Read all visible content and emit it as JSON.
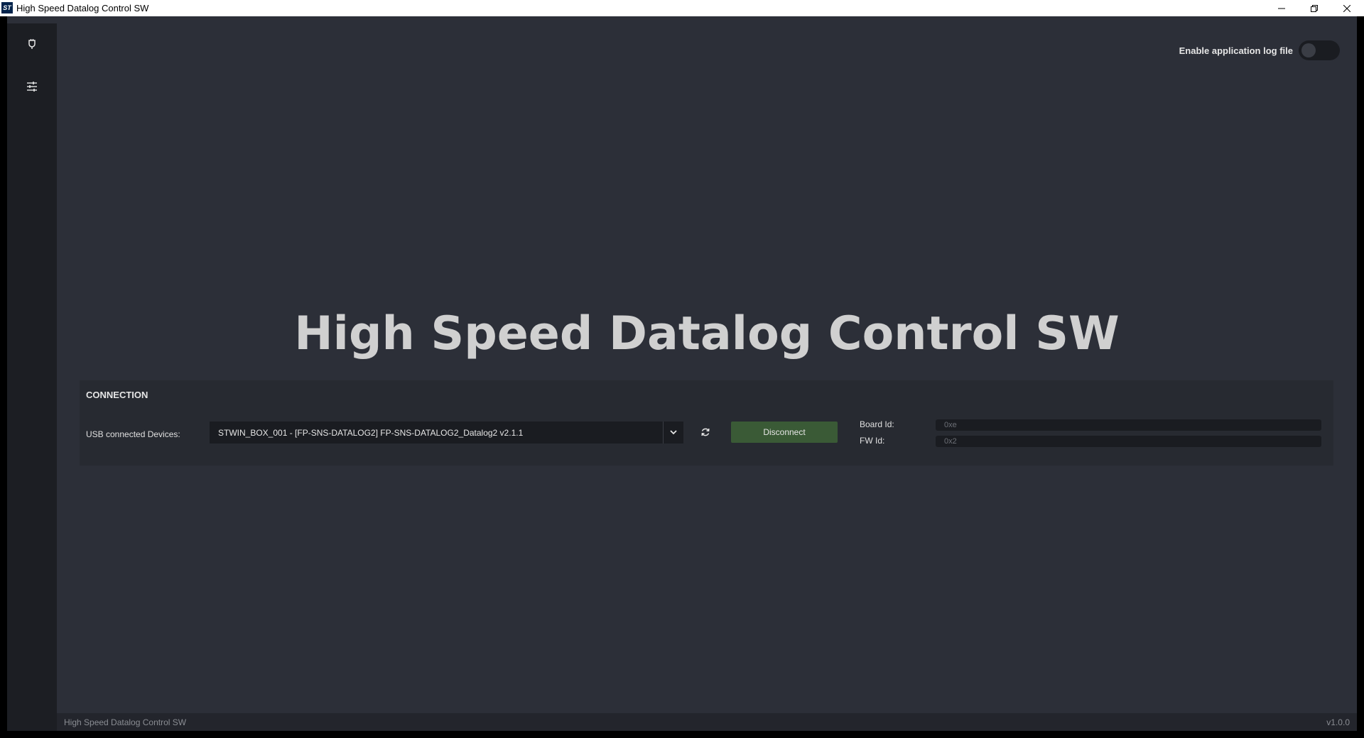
{
  "window": {
    "title": "High Speed Datalog Control SW",
    "app_icon_text": "ST"
  },
  "sidebar": {
    "items": [
      {
        "name": "connection",
        "icon": "plug-icon",
        "active": true
      },
      {
        "name": "settings",
        "icon": "sliders-icon",
        "active": false
      }
    ]
  },
  "header": {
    "log_toggle_label": "Enable application log file",
    "log_toggle_on": false
  },
  "main": {
    "big_title": "High Speed Datalog Control SW"
  },
  "connection": {
    "title": "CONNECTION",
    "usb_label": "USB connected Devices:",
    "selected_device": "STWIN_BOX_001 - [FP-SNS-DATALOG2] FP-SNS-DATALOG2_Datalog2 v2.1.1",
    "disconnect_label": "Disconnect",
    "board_id_label": "Board Id:",
    "board_id_value": "0xe",
    "fw_id_label": "FW Id:",
    "fw_id_value": "0x2"
  },
  "statusbar": {
    "left": "High Speed Datalog Control SW",
    "right": "v1.0.0"
  },
  "colors": {
    "accent_green": "#2e9e34",
    "disconnect_bg": "#3a5a36",
    "panel_bg": "#272a31",
    "main_bg": "#2c2f38"
  }
}
